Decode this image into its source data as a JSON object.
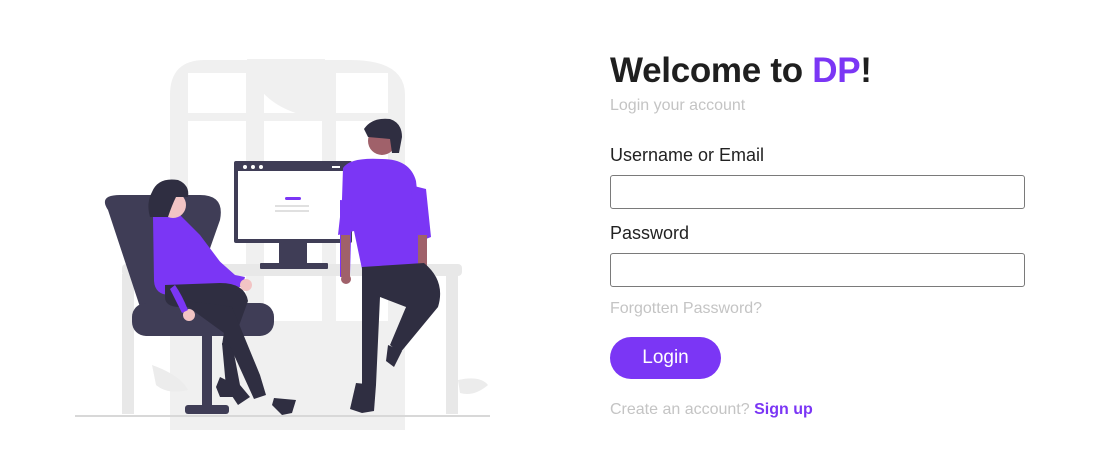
{
  "header": {
    "welcome_prefix": "Welcome to ",
    "brand": "DP",
    "welcome_suffix": "!",
    "subtitle": "Login your account"
  },
  "form": {
    "username_label": "Username or Email",
    "username_value": "",
    "password_label": "Password",
    "password_value": "",
    "forgot_link": "Forgotten Password?",
    "login_button": "Login",
    "signup_prompt": "Create an account?",
    "signup_link": "Sign up"
  },
  "colors": {
    "accent": "#7b36f5",
    "heading": "#1f1f1f",
    "muted": "#c4c4c4",
    "input_border": "#7a7a7a"
  }
}
